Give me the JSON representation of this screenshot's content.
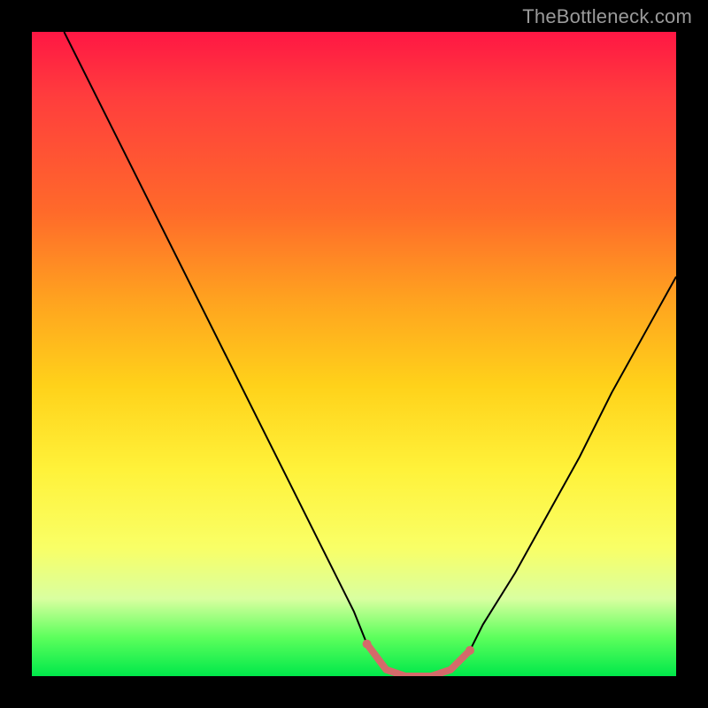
{
  "watermark": "TheBottleneck.com",
  "chart_data": {
    "type": "line",
    "title": "",
    "xlabel": "",
    "ylabel": "",
    "xlim": [
      0,
      100
    ],
    "ylim": [
      0,
      100
    ],
    "background": {
      "type": "vertical-gradient",
      "stops": [
        {
          "pos": 0,
          "color": "#ff1744"
        },
        {
          "pos": 10,
          "color": "#ff3d3d"
        },
        {
          "pos": 28,
          "color": "#ff6a2a"
        },
        {
          "pos": 42,
          "color": "#ffa41f"
        },
        {
          "pos": 55,
          "color": "#ffd21a"
        },
        {
          "pos": 68,
          "color": "#fff23a"
        },
        {
          "pos": 80,
          "color": "#f9ff66"
        },
        {
          "pos": 88,
          "color": "#d9ffa0"
        },
        {
          "pos": 94,
          "color": "#5cff5c"
        },
        {
          "pos": 100,
          "color": "#00e84a"
        }
      ]
    },
    "series": [
      {
        "name": "curve",
        "stroke": "#000000",
        "stroke_width": 2,
        "x": [
          5,
          10,
          15,
          20,
          25,
          30,
          35,
          40,
          45,
          50,
          52,
          55,
          58,
          62,
          65,
          68,
          70,
          75,
          80,
          85,
          90,
          95,
          100
        ],
        "values": [
          100,
          90,
          80,
          70,
          60,
          50,
          40,
          30,
          20,
          10,
          5,
          1,
          0,
          0,
          1,
          4,
          8,
          16,
          25,
          34,
          44,
          53,
          62
        ]
      },
      {
        "name": "highlight",
        "stroke": "#d46a6a",
        "stroke_width": 8,
        "x": [
          52,
          55,
          58,
          62,
          65,
          68
        ],
        "values": [
          5,
          1,
          0,
          0,
          1,
          4
        ],
        "end_caps": true
      }
    ]
  }
}
